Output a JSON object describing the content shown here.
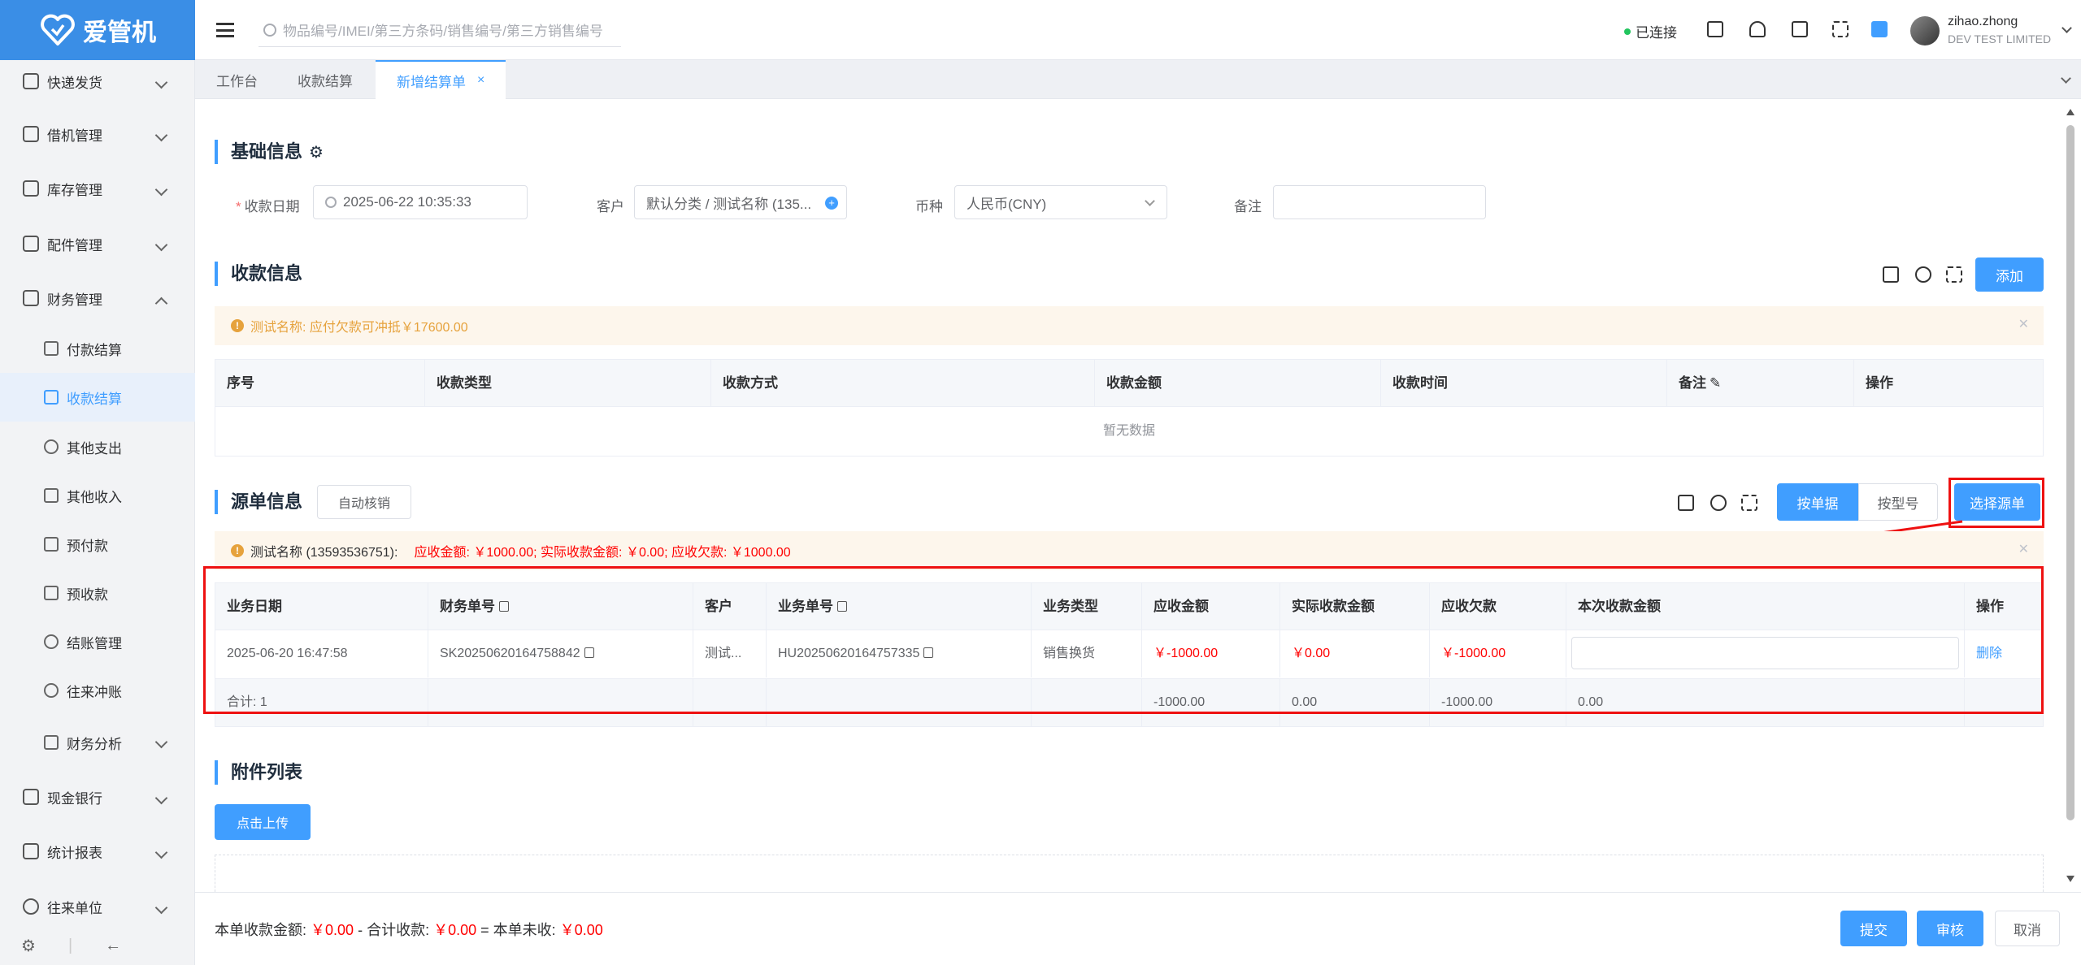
{
  "app": {
    "logo_text": "爱管机"
  },
  "sidebar": {
    "items": [
      {
        "label": "快递发货",
        "icon": "truck-icon"
      },
      {
        "label": "借机管理",
        "icon": "phone-icon"
      },
      {
        "label": "库存管理",
        "icon": "warehouse-icon"
      },
      {
        "label": "配件管理",
        "icon": "parts-icon"
      },
      {
        "label": "财务管理",
        "icon": "yen-icon"
      }
    ],
    "sub_items": [
      {
        "label": "付款结算",
        "icon": "pay-icon"
      },
      {
        "label": "收款结算",
        "icon": "receive-icon",
        "active": true
      },
      {
        "label": "其他支出",
        "icon": "dots-icon"
      },
      {
        "label": "其他收入",
        "icon": "income-icon"
      },
      {
        "label": "预付款",
        "icon": "prepay-icon"
      },
      {
        "label": "预收款",
        "icon": "prereceive-icon"
      },
      {
        "label": "结账管理",
        "icon": "history-icon"
      },
      {
        "label": "往来冲账",
        "icon": "offset-icon"
      },
      {
        "label": "财务分析",
        "icon": "analysis-icon"
      }
    ],
    "items_bottom": [
      {
        "label": "现金银行",
        "icon": "bank-icon"
      },
      {
        "label": "统计报表",
        "icon": "report-icon"
      },
      {
        "label": "往来单位",
        "icon": "contacts-icon"
      }
    ]
  },
  "header": {
    "search_placeholder": "物品编号/IMEI/第三方条码/销售编号/第三方销售编号",
    "status": "已连接",
    "user_name": "zihao.zhong",
    "user_company": "DEV TEST LIMITED"
  },
  "tabs": [
    {
      "label": "工作台"
    },
    {
      "label": "收款结算"
    },
    {
      "label": "新增结算单",
      "close": "×"
    }
  ],
  "basic": {
    "title": "基础信息",
    "date_label": "收款日期",
    "date_required": "*",
    "date_value": "2025-06-22 10:35:33",
    "customer_label": "客户",
    "customer_value": "默认分类 / 测试名称 (135...",
    "currency_label": "币种",
    "currency_value": "人民币(CNY)",
    "remark_label": "备注",
    "remark_value": ""
  },
  "receipt": {
    "title": "收款信息",
    "add_button": "添加",
    "alert": "测试名称:  应付欠款可冲抵￥17600.00",
    "columns": [
      "序号",
      "收款类型",
      "收款方式",
      "收款金额",
      "收款时间",
      "备注",
      "操作"
    ],
    "empty_text": "暂无数据"
  },
  "source": {
    "title": "源单信息",
    "auto_btn": "自动核销",
    "seg_by_doc": "按单据",
    "seg_by_model": "按型号",
    "select_btn": "选择源单",
    "alert_name": "测试名称 (13593536751):",
    "alert_detail": "应收金额: ￥1000.00;  实际收款金额: ￥0.00;  应收欠款: ￥1000.00",
    "columns": [
      "业务日期",
      "财务单号",
      "客户",
      "业务单号",
      "业务类型",
      "应收金额",
      "实际收款金额",
      "应收欠款",
      "本次收款金额",
      "操作"
    ],
    "row": {
      "date": "2025-06-20 16:47:58",
      "fin_no": "SK20250620164758842",
      "customer": "测试...",
      "biz_no": "HU20250620164757335",
      "biz_type": "销售换货",
      "receivable": "￥-1000.00",
      "actual": "￥0.00",
      "owed": "￥-1000.00",
      "this_amount": "",
      "action": "删除"
    },
    "total": {
      "label": "合计: 1",
      "receivable": "-1000.00",
      "actual": "0.00",
      "owed": "-1000.00",
      "this_amount": "0.00"
    }
  },
  "attachments": {
    "title": "附件列表",
    "upload_btn": "点击上传"
  },
  "footer": {
    "label_this": "本单收款金额:",
    "val_this": "￥0.00",
    "minus": "- 合计收款:",
    "val_total": "￥0.00",
    "eq": "= 本单未收:",
    "val_unpaid": "￥0.00",
    "submit": "提交",
    "review": "审核",
    "cancel": "取消"
  }
}
